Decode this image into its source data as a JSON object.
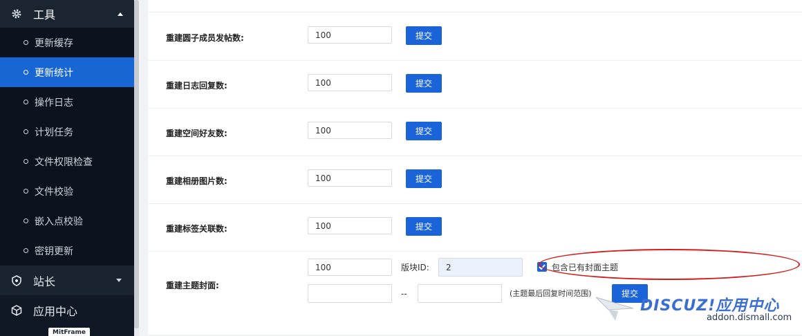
{
  "sidebar": {
    "section_title": "工具",
    "items": [
      {
        "label": "更新缓存",
        "active": false
      },
      {
        "label": "更新统计",
        "active": true
      },
      {
        "label": "操作日志",
        "active": false
      },
      {
        "label": "计划任务",
        "active": false
      },
      {
        "label": "文件权限检查",
        "active": false
      },
      {
        "label": "文件校验",
        "active": false
      },
      {
        "label": "嵌入点校验",
        "active": false
      },
      {
        "label": "密钥更新",
        "active": false
      }
    ],
    "groups": [
      {
        "label": "站长",
        "icon": "shield-icon"
      },
      {
        "label": "应用中心",
        "icon": "cube-icon"
      }
    ],
    "bottom_logo_text": "MitFrame"
  },
  "form": {
    "rows": [
      {
        "label": "重建圆子成员发帖数:",
        "value": "100",
        "button": "提交"
      },
      {
        "label": "重建日志回复数:",
        "value": "100",
        "button": "提交"
      },
      {
        "label": "重建空间好友数:",
        "value": "100",
        "button": "提交"
      },
      {
        "label": "重建相册图片数:",
        "value": "100",
        "button": "提交"
      },
      {
        "label": "重建标签关联数:",
        "value": "100",
        "button": "提交"
      }
    ],
    "cover": {
      "label": "重建主题封面:",
      "value": "100",
      "forum_id_label": "版块ID:",
      "forum_id_value": "2",
      "checkbox_label": "包含已有封面主题",
      "checkbox_checked": true,
      "range_start": "",
      "range_separator": "--",
      "range_end": "",
      "range_hint": "(主题最后回复时间范围)",
      "button": "提交"
    }
  },
  "watermark": {
    "brand": "DISCUZ!应用中心",
    "url": "addon.dismall.com"
  },
  "colors": {
    "accent": "#1a63d8",
    "sidebar_bg": "#0f1824",
    "highlight_oval": "#d21d1d"
  }
}
